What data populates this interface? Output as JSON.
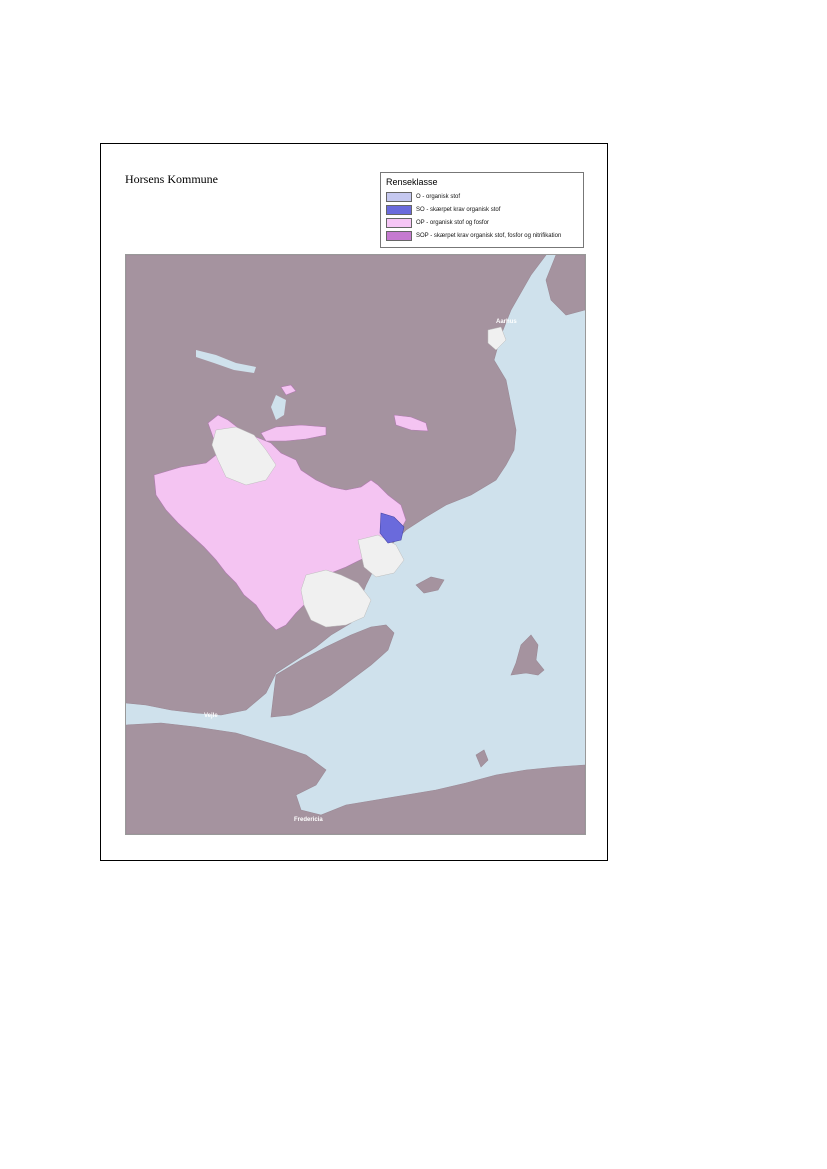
{
  "map_title": "Horsens Kommune",
  "legend": {
    "title": "Renseklasse",
    "items": [
      {
        "label": "O - organisk stof",
        "color": "#c5c8f0"
      },
      {
        "label": "SO - skærpet krav organisk stof",
        "color": "#6a6adc"
      },
      {
        "label": "OP - organisk stof og fosfor",
        "color": "#f6c6f6"
      },
      {
        "label": "SOP - skærpet krav organisk stof, fosfor og nitrifikation",
        "color": "#c57ad0"
      }
    ]
  },
  "places": {
    "aarhus": "Aarhus",
    "vejle": "Vejle",
    "fredericia": "Fredericia"
  },
  "colors": {
    "land": "#a5939f",
    "sea": "#cfe1ec",
    "municipality": "#f4c4f2",
    "urban": "#f0f0f0"
  }
}
